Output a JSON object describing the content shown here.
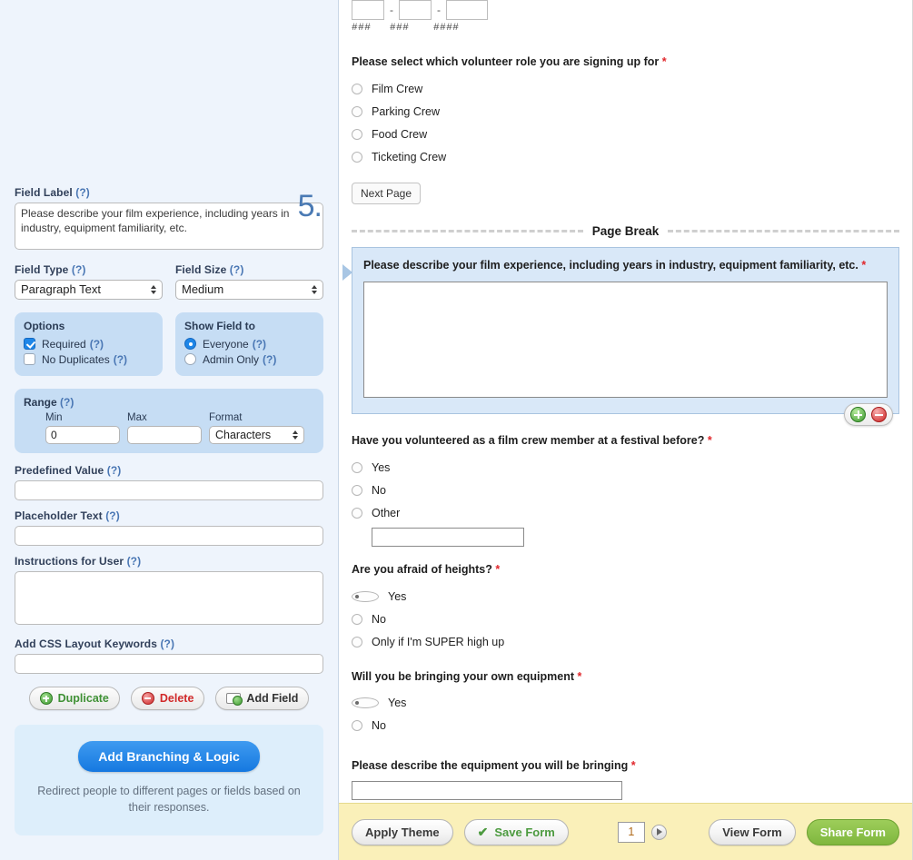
{
  "sidebar": {
    "field_number": "5.",
    "field_label": {
      "label": "Field Label",
      "help": "(?)",
      "value": "Please describe your film experience, including years in industry, equipment familiarity, etc."
    },
    "field_type": {
      "label": "Field Type",
      "help": "(?)",
      "value": "Paragraph Text",
      "options": [
        "Paragraph Text"
      ]
    },
    "field_size": {
      "label": "Field Size",
      "help": "(?)",
      "value": "Medium",
      "options": [
        "Medium"
      ]
    },
    "options_group": {
      "title": "Options",
      "items": [
        {
          "label": "Required",
          "help": "(?)",
          "checked": true
        },
        {
          "label": "No Duplicates",
          "help": "(?)",
          "checked": false
        }
      ]
    },
    "show_field_to": {
      "title": "Show Field to",
      "items": [
        {
          "label": "Everyone",
          "help": "(?)",
          "selected": true
        },
        {
          "label": "Admin Only",
          "help": "(?)",
          "selected": false
        }
      ]
    },
    "range": {
      "title": "Range",
      "help": "(?)",
      "min_label": "Min",
      "min_value": "0",
      "max_label": "Max",
      "max_value": "",
      "format_label": "Format",
      "format_value": "Characters",
      "format_options": [
        "Characters"
      ]
    },
    "predefined_value": {
      "label": "Predefined Value",
      "help": "(?)",
      "value": ""
    },
    "placeholder_text": {
      "label": "Placeholder Text",
      "help": "(?)",
      "value": ""
    },
    "instructions": {
      "label": "Instructions for User",
      "help": "(?)",
      "value": ""
    },
    "css_keywords": {
      "label": "Add CSS Layout Keywords",
      "help": "(?)",
      "value": ""
    },
    "actions": {
      "duplicate": "Duplicate",
      "delete": "Delete",
      "add_field": "Add Field"
    },
    "branching": {
      "button": "Add Branching & Logic",
      "description": "Redirect people to different pages or fields based on their responses."
    }
  },
  "form": {
    "phone": {
      "hint1": "###",
      "hint2": "###",
      "hint3": "####",
      "sep": "-"
    },
    "volunteer_role": {
      "title": "Please select which volunteer role you are signing up for",
      "required_mark": "*",
      "options": [
        {
          "label": "Film Crew",
          "selected": false
        },
        {
          "label": "Parking Crew",
          "selected": false
        },
        {
          "label": "Food Crew",
          "selected": false
        },
        {
          "label": "Ticketing Crew",
          "selected": false
        }
      ]
    },
    "next_page_button": "Next Page",
    "page_break_label": "Page Break",
    "selected_field": {
      "title": "Please describe your film experience, including years in industry, equipment familiarity, etc.",
      "required_mark": "*",
      "textarea_value": ""
    },
    "volunteered_before": {
      "title": "Have you volunteered as a film crew member at a festival before?",
      "required_mark": "*",
      "options": [
        {
          "label": "Yes",
          "selected": false
        },
        {
          "label": "No",
          "selected": false
        },
        {
          "label": "Other",
          "selected": false
        }
      ],
      "other_value": ""
    },
    "afraid_heights": {
      "title": "Are you afraid of heights?",
      "required_mark": "*",
      "options": [
        {
          "label": "Yes",
          "selected": true
        },
        {
          "label": "No",
          "selected": false
        },
        {
          "label": "Only if I'm SUPER high up",
          "selected": false
        }
      ]
    },
    "own_equipment": {
      "title": "Will you be bringing your own equipment",
      "required_mark": "*",
      "options": [
        {
          "label": "Yes",
          "selected": true
        },
        {
          "label": "No",
          "selected": false
        }
      ]
    },
    "describe_equipment": {
      "title": "Please describe the equipment you will be bringing",
      "required_mark": "*",
      "value": ""
    }
  },
  "footer": {
    "apply_theme": "Apply Theme",
    "save_form": "Save Form",
    "save_check": "✔",
    "page_number": "1",
    "view_form": "View Form",
    "share_form": "Share Form"
  },
  "colors": {
    "sidebar_bg": "#eef4fc",
    "group_bg": "#c6ddf4",
    "selected_field_bg": "#d9e8f8",
    "accent_blue": "#1578e0",
    "footer_bg": "#faf0b9",
    "share_green": "#7fb73e",
    "required_red": "#e0262b",
    "number_blue": "#4a7ab4"
  }
}
